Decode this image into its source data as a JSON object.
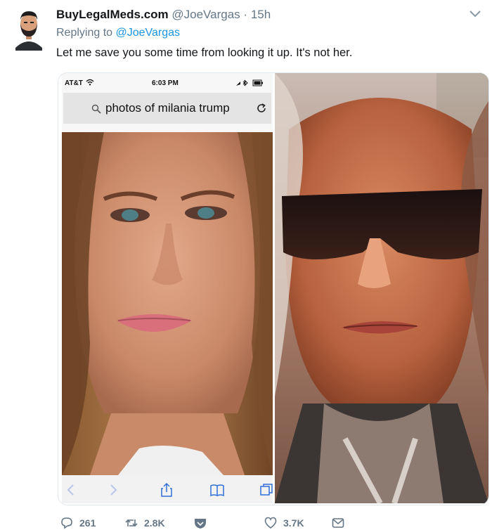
{
  "tweet": {
    "display_name": "BuyLegalMeds.com",
    "handle": "@JoeVargas",
    "separator": "·",
    "time": "15h",
    "replying_prefix": "Replying to ",
    "replying_to": "@JoeVargas",
    "text": "Let me save you some time from looking it up. It's not her."
  },
  "screenshot": {
    "carrier": "AT&T",
    "time": "6:03 PM",
    "search_query": "photos of milania trump"
  },
  "actions": {
    "replies": "261",
    "retweets": "2.8K",
    "likes": "3.7K"
  },
  "colors": {
    "link": "#1b95e0",
    "muted": "#657786",
    "text": "#14171a"
  },
  "icons": [
    "avatar",
    "chevron-down-icon",
    "wifi-icon",
    "search-icon",
    "reload-icon",
    "share-icon",
    "bookmarks-icon",
    "tabs-icon",
    "reply-icon",
    "retweet-icon",
    "heart-icon",
    "mail-icon"
  ]
}
